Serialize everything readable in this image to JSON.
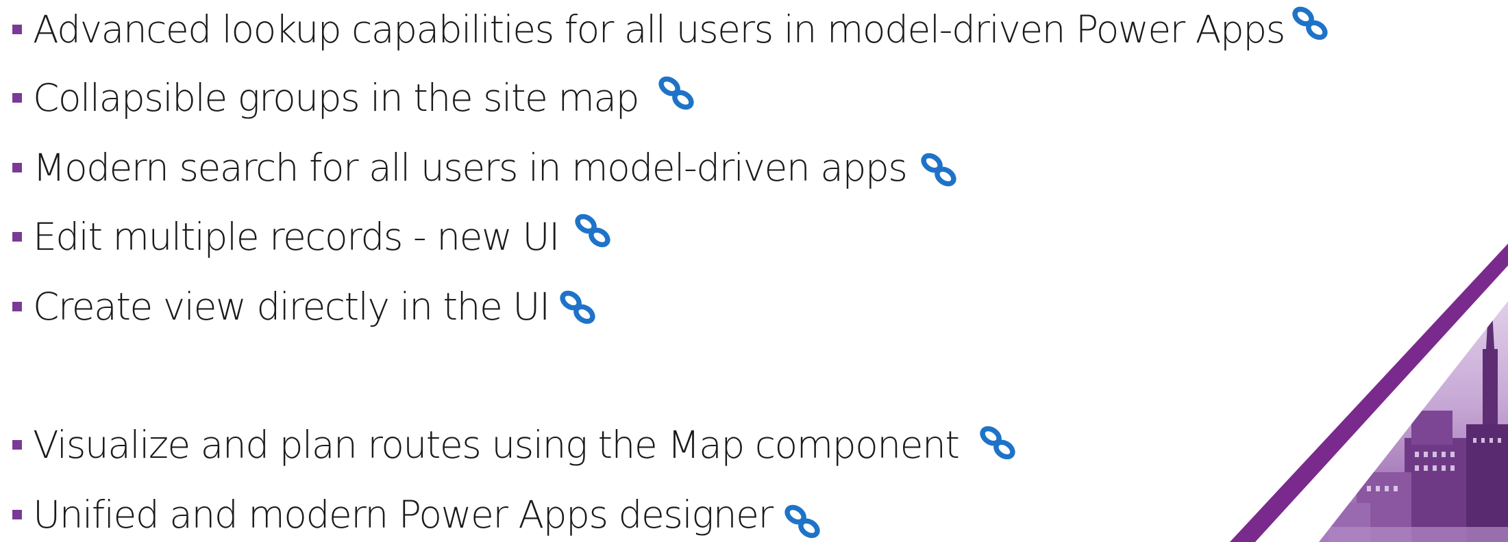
{
  "bullets": [
    {
      "text": "Advanced lookup capabilities for all users in model-driven Power Apps",
      "icon": "link-icon"
    },
    {
      "text": "Collapsible groups in the site map",
      "icon": "link-icon"
    },
    {
      "text": "Modern search for all users in model-driven apps",
      "icon": "link-icon"
    },
    {
      "text": "Edit multiple records - new UI",
      "icon": "link-icon"
    },
    {
      "text": "Create view directly in the UI",
      "icon": "link-icon"
    },
    {
      "text": "Visualize and plan routes using the Map component",
      "icon": "link-icon"
    },
    {
      "text": "Unified and modern Power Apps designer",
      "icon": "link-icon"
    }
  ],
  "colors": {
    "bullet": "#7b3a96",
    "link_icon": "#1e73c8",
    "accent_stripe": "#7a2a8c",
    "photo_tint": "#a57bb6"
  },
  "decoration": "city-skyline-photo"
}
